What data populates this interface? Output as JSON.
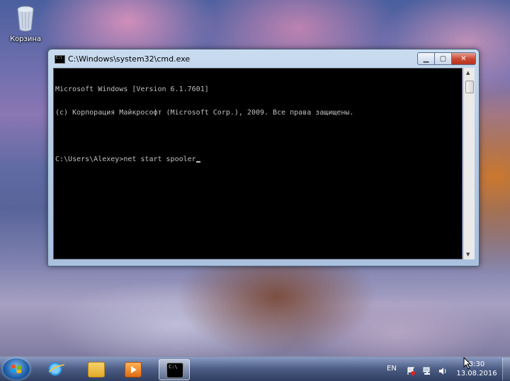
{
  "desktop": {
    "recycle_bin_label": "Корзина"
  },
  "window": {
    "title": "C:\\Windows\\system32\\cmd.exe",
    "console_lines": [
      "Microsoft Windows [Version 6.1.7601]",
      "(с) Корпорация Майкрософт (Microsoft Corp.), 2009. Все права защищены.",
      "",
      "C:\\Users\\Alexey>net start spooler"
    ],
    "buttons": {
      "minimize": "minimize",
      "maximize": "maximize",
      "close": "close"
    }
  },
  "taskbar": {
    "pinned": [
      "start-button",
      "internet-explorer-icon",
      "windows-explorer-icon",
      "media-player-icon",
      "cmd-icon"
    ],
    "language": "EN",
    "time": "8:30",
    "date": "13.08.2016"
  },
  "colors": {
    "console_bg": "#000000",
    "console_text": "#c0c0c0",
    "close_button": "#c7452e"
  }
}
